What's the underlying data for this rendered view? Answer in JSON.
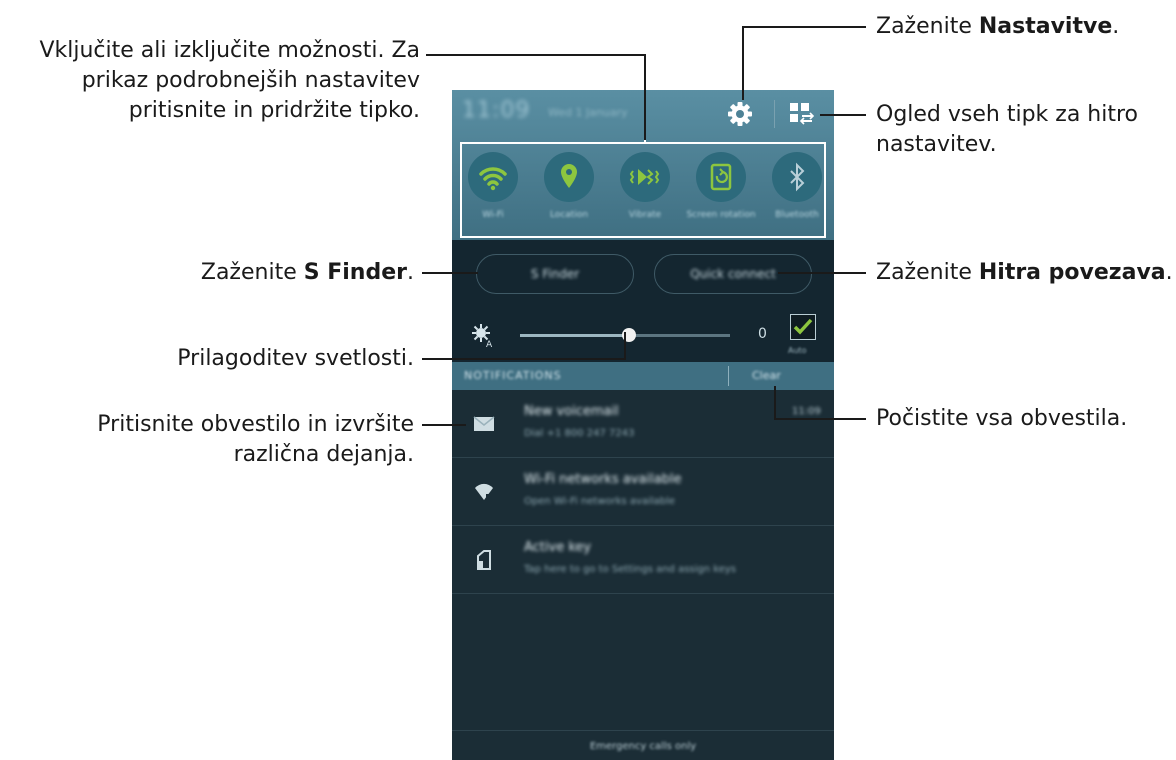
{
  "callouts": {
    "toggles": [
      "Vključite ali izključite možnosti. Za",
      "prikaz podrobnejših nastavitev",
      "pritisnite in pridržite tipko."
    ],
    "settings": {
      "prefix": "Zaženite ",
      "bold": "Nastavitve",
      "suffix": "."
    },
    "quick_buttons": [
      "Ogled vseh tipk za hitro",
      "nastavitev."
    ],
    "s_finder": {
      "prefix": "Zaženite ",
      "bold": "S Finder",
      "suffix": "."
    },
    "quick_connect": {
      "prefix": "Zaženite ",
      "bold": "Hitra povezava",
      "suffix": "."
    },
    "brightness": "Prilagoditev svetlosti.",
    "notification": [
      "Pritisnite obvestilo in izvršite",
      "različna dejanja."
    ],
    "clear": "Počistite vsa obvestila."
  },
  "phone": {
    "status": {
      "time": "11:09",
      "date": "Wed 1 January"
    },
    "icons": {
      "settings": "gear-icon",
      "quick_grid": "grid-swap-icon"
    },
    "toggles": [
      {
        "label": "Wi-Fi",
        "icon": "wifi-icon"
      },
      {
        "label": "Location",
        "icon": "location-icon"
      },
      {
        "label": "Vibrate",
        "icon": "vibrate-icon"
      },
      {
        "label": "Screen rotation",
        "icon": "rotation-icon"
      },
      {
        "label": "Bluetooth",
        "icon": "bluetooth-icon"
      }
    ],
    "buttons": {
      "s_finder": "S Finder",
      "quick_connect": "Quick connect"
    },
    "brightness": {
      "value": "0",
      "level": 0.52,
      "auto_label": "Auto",
      "auto_checked": true
    },
    "notifications_header": {
      "title": "NOTIFICATIONS",
      "clear": "Clear"
    },
    "notifications": [
      {
        "title": "New voicemail",
        "subtitle": "Dial +1 800 247 7243",
        "time": "11:09",
        "icon": "mail-icon"
      },
      {
        "title": "Wi-Fi networks available",
        "subtitle": "Open Wi-Fi networks available",
        "time": "",
        "icon": "wifi-signal-icon"
      },
      {
        "title": "Active key",
        "subtitle": "Tap here to go to Settings and assign keys",
        "time": "",
        "icon": "key-icon"
      }
    ],
    "bottom": "Emergency calls only"
  },
  "colors": {
    "accent_green": "#8dc63f",
    "panel_blue": "#3f6f82"
  }
}
